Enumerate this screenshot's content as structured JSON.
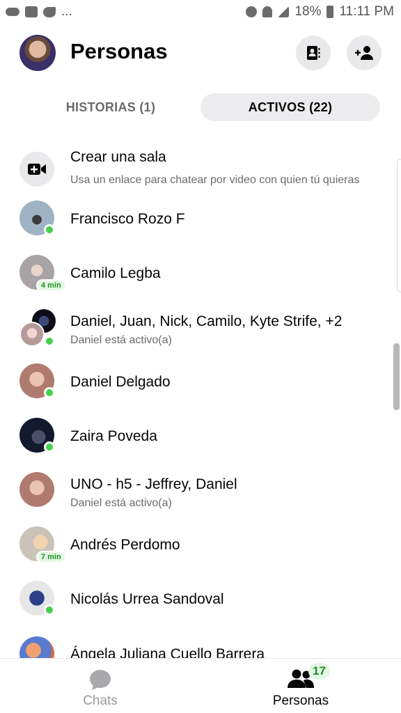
{
  "status_bar": {
    "left_icons": [
      "cloud-icon",
      "twitch-icon",
      "twitter-icon"
    ],
    "more": "...",
    "battery": "18%",
    "time": "11:11 PM"
  },
  "header": {
    "title": "Personas",
    "contacts_icon": "contacts-book-icon",
    "add_icon": "add-person-icon"
  },
  "tabs": {
    "historias": "HISTORIAS (1)",
    "activos": "ACTIVOS (22)"
  },
  "create_room": {
    "title": "Crear una sala",
    "subtitle": "Usa un enlace para chatear por video con quien tú quieras"
  },
  "people": [
    {
      "name": "Francisco Rozo F",
      "sub": "",
      "badge": "",
      "color": "#8f9aa6"
    },
    {
      "name": "Camilo Legba",
      "sub": "",
      "badge": "4 min",
      "color": "#c6c3c4"
    },
    {
      "name": "Daniel, Juan, Nick, Camilo, Kyte Strife, +2",
      "sub": "Daniel está activo(a)",
      "badge": "",
      "color": "#b6a7a8"
    },
    {
      "name": "Daniel Delgado",
      "sub": "",
      "badge": "",
      "color": "#c79a8c"
    },
    {
      "name": "Zaira Poveda",
      "sub": "",
      "badge": "",
      "color": "#1f2a4a"
    },
    {
      "name": "UNO - h5 - Jeffrey, Daniel",
      "sub": "Daniel está activo(a)",
      "badge": "",
      "color": "#c79a8c"
    },
    {
      "name": "Andrés Perdomo",
      "sub": "",
      "badge": "7 min",
      "color": "#d9d1c4"
    },
    {
      "name": "Nicolás Urrea Sandoval",
      "sub": "",
      "badge": "",
      "color": "#2b3f8a"
    },
    {
      "name": "Ángela Juliana Cuello Barrera",
      "sub": "",
      "badge": "",
      "color": "#d06b4a"
    }
  ],
  "bottom_nav": {
    "chats": "Chats",
    "personas": "Personas",
    "badge": "17"
  }
}
